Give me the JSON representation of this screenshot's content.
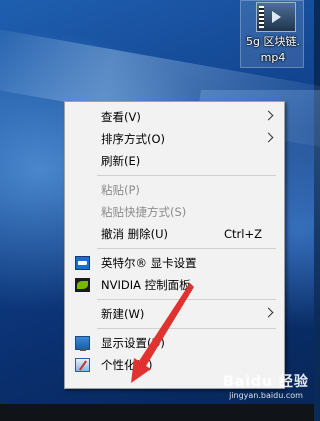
{
  "desktop_file": {
    "label_line1": "5g 区块链.",
    "label_line2": "mp4"
  },
  "context_menu": {
    "items": [
      {
        "label": "查看(V)",
        "submenu": true,
        "enabled": true
      },
      {
        "label": "排序方式(O)",
        "submenu": true,
        "enabled": true
      },
      {
        "label": "刷新(E)",
        "submenu": false,
        "enabled": true
      },
      {
        "label": "粘贴(P)",
        "submenu": false,
        "enabled": false
      },
      {
        "label": "粘贴快捷方式(S)",
        "submenu": false,
        "enabled": false
      },
      {
        "label": "撤消 删除(U)",
        "shortcut": "Ctrl+Z",
        "enabled": true
      },
      {
        "label": "英特尔® 显卡设置",
        "icon": "intel-graphics-icon",
        "enabled": true
      },
      {
        "label": "NVIDIA 控制面板",
        "icon": "nvidia-icon",
        "enabled": true
      },
      {
        "label": "新建(W)",
        "submenu": true,
        "enabled": true
      },
      {
        "label": "显示设置(D)",
        "icon": "display-settings-icon",
        "enabled": true
      },
      {
        "label": "个性化(R)",
        "icon": "personalize-icon",
        "enabled": true
      }
    ]
  },
  "watermark": {
    "logo": "Baidu 经验",
    "url": "jingyan.baidu.com"
  },
  "colors": {
    "annotation_arrow": "#e0322f",
    "menu_background": "#f2f2f2",
    "disabled_text": "#8c8c8c"
  }
}
